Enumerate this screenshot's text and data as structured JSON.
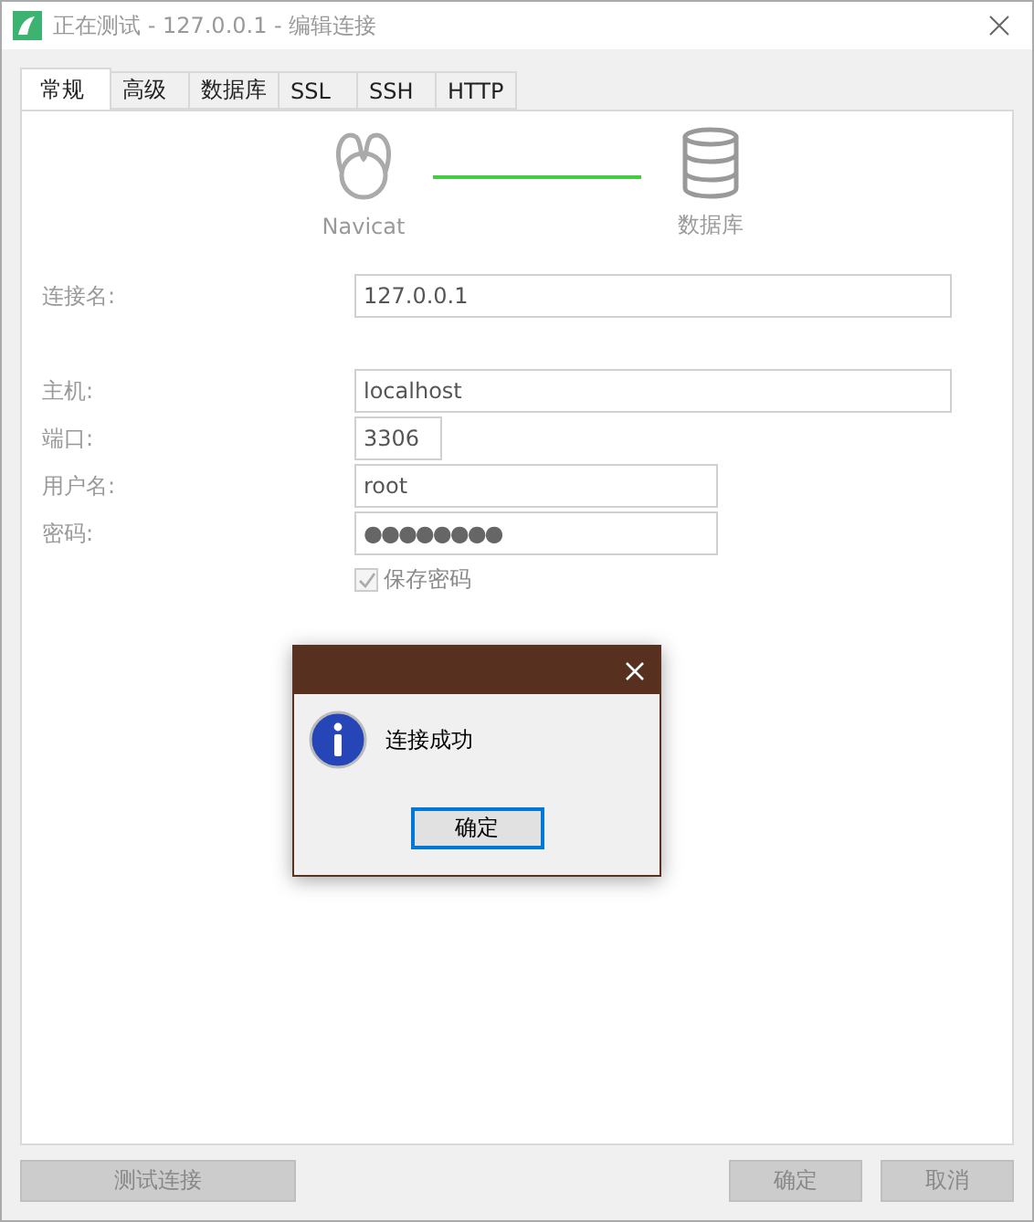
{
  "window": {
    "title": "正在测试 - 127.0.0.1 - 编辑连接"
  },
  "tabs": [
    {
      "label": "常规",
      "selected": true
    },
    {
      "label": "高级",
      "selected": false
    },
    {
      "label": "数据库",
      "selected": false
    },
    {
      "label": "SSL",
      "selected": false
    },
    {
      "label": "SSH",
      "selected": false
    },
    {
      "label": "HTTP",
      "selected": false
    }
  ],
  "diagram": {
    "source_label": "Navicat",
    "target_label": "数据库"
  },
  "connection_name": {
    "label": "连接名:",
    "value": "127.0.0.1"
  },
  "fields": [
    {
      "label": "主机:",
      "value": "localhost",
      "kind": "text"
    },
    {
      "label": "端口:",
      "value": "3306",
      "kind": "text"
    },
    {
      "label": "用户名:",
      "value": "root",
      "kind": "text"
    },
    {
      "label": "密码:",
      "value": "●●●●●●●●",
      "kind": "password"
    }
  ],
  "save_password": {
    "label": "保存密码",
    "checked": true,
    "disabled": true
  },
  "dialog": {
    "message": "连接成功",
    "button": "确定"
  },
  "buttons": [
    {
      "label": "测试连接",
      "disabled": true
    },
    {
      "label": "确定",
      "disabled": true
    },
    {
      "label": "取消",
      "disabled": true
    }
  ]
}
